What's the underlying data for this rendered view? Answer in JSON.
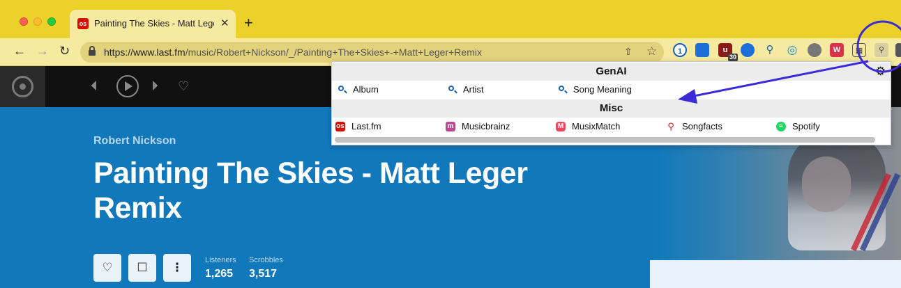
{
  "browser": {
    "tab_title": "Painting The Skies - Matt Leger Remix",
    "tab_favicon": "os",
    "tab_close": "✕",
    "new_tab": "+",
    "url_host": "https://www.last.fm",
    "url_path": "/music/Robert+Nickson/_/Painting+The+Skies+-+Matt+Leger+Remix",
    "extensions": [
      {
        "name": "1password-icon",
        "badge": ""
      },
      {
        "name": "bookmark-ext-icon",
        "badge": ""
      },
      {
        "name": "ublock-icon",
        "badge": "30"
      },
      {
        "name": "blue-circle-ext-icon",
        "badge": ""
      },
      {
        "name": "search-ext-icon",
        "badge": ""
      },
      {
        "name": "globe-ext-icon",
        "badge": ""
      },
      {
        "name": "red-dot-ext-icon",
        "badge": "on"
      },
      {
        "name": "w-ext-icon",
        "badge": ""
      },
      {
        "name": "puzzle-ext-icon",
        "badge": ""
      },
      {
        "name": "search-menu-ext-icon",
        "badge": ""
      },
      {
        "name": "more-ext-icon",
        "badge": ""
      }
    ],
    "ublock_badge": "30"
  },
  "page": {
    "artist": "Robert Nickson",
    "track_title": "Painting The Skies - Matt Leger Remix",
    "stats": {
      "listeners_label": "Listeners",
      "listeners_value": "1,265",
      "scrobbles_label": "Scrobbles",
      "scrobbles_value": "3,517"
    }
  },
  "popup": {
    "section1": "GenAI",
    "genai_items": [
      "Album",
      "Artist",
      "Song Meaning"
    ],
    "section2": "Misc",
    "misc_items": [
      "Last.fm",
      "Musicbrainz",
      "MusixMatch",
      "Songfacts",
      "Spotify"
    ]
  },
  "colors": {
    "tab_bar": "#ecd12b",
    "hero_blue": "#1179bb",
    "annotation": "#3a2bd8"
  }
}
